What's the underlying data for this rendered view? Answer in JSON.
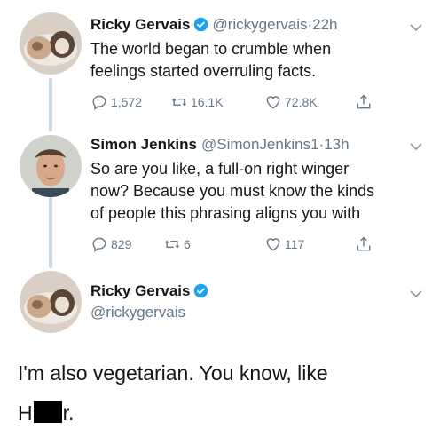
{
  "tweets": [
    {
      "name": "Ricky Gervais",
      "handle": "@rickygervais",
      "time": "22h",
      "text_lines": [
        "The world began to crumble when",
        "feelings started overruling facts."
      ],
      "replies": "1,572",
      "retweets": "16.1K",
      "likes": "72.8K"
    },
    {
      "name": "Simon Jenkins",
      "handle": "@SimonJenkins1",
      "time": "13h",
      "text_lines": [
        "So are you like, a full-on right winger",
        "now? Because you must know the kinds",
        "of people this phrasing aligns you with"
      ],
      "replies": "829",
      "retweets": "6",
      "likes": "117"
    },
    {
      "name": "Ricky Gervais",
      "handle": "@rickygervais",
      "text_line1": "I'm also vegetarian. You know, like",
      "text_line2_start": "H",
      "text_line2_end": "r."
    }
  ],
  "separator": "·",
  "colors": {
    "text": "#14171a",
    "secondary": "#657786",
    "verified": "#1da1f2",
    "thread_line": "#ccd6dd"
  }
}
